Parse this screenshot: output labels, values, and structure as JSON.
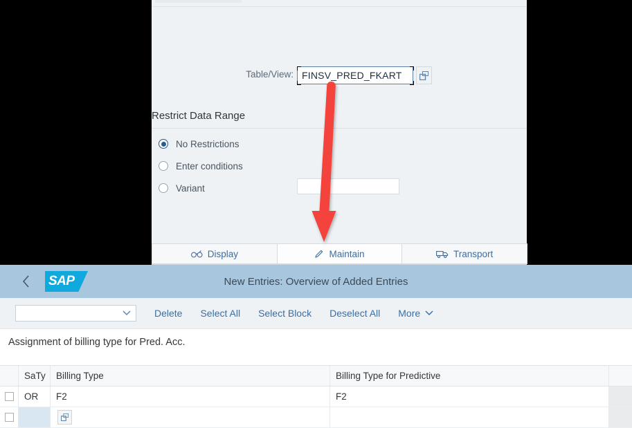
{
  "dialog": {
    "table_view": {
      "label": "Table/View:",
      "value": "FINSV_PRED_FKART",
      "help_icon": "value-help-icon"
    },
    "section_title": "Restrict Data Range",
    "radios": [
      {
        "label": "No Restrictions",
        "selected": true
      },
      {
        "label": "Enter conditions",
        "selected": false
      },
      {
        "label": "Variant",
        "selected": false
      }
    ],
    "variant_value": "",
    "buttons": [
      {
        "label": "Display",
        "icon": "glasses-icon"
      },
      {
        "label": "Maintain",
        "icon": "pencil-icon"
      },
      {
        "label": "Transport",
        "icon": "truck-icon"
      }
    ]
  },
  "annotation": {
    "arrow_color": "#F4433C",
    "points_to": "Maintain"
  },
  "shell": {
    "back_icon": "chevron-left-icon",
    "logo_text": "SAP",
    "title": "New Entries: Overview of Added Entries",
    "bar_color": "#A8C6DD",
    "logo_color": "#10A9DD"
  },
  "toolbar": {
    "select_value": "",
    "select_icon": "chevron-down-icon",
    "items": [
      {
        "label": "Delete"
      },
      {
        "label": "Select All"
      },
      {
        "label": "Select Block"
      },
      {
        "label": "Deselect All"
      },
      {
        "label": "More",
        "icon": "chevron-down-icon"
      }
    ]
  },
  "table": {
    "caption": "Assignment of billing type for Pred. Acc.",
    "columns": [
      "",
      "SaTy",
      "Billing Type",
      "Billing Type for Predictive",
      ""
    ],
    "rows": [
      {
        "saty": "OR",
        "billing_type": "F2",
        "billing_type_predictive": "F2"
      },
      {
        "saty": "",
        "billing_type": "",
        "billing_type_predictive": ""
      }
    ]
  }
}
